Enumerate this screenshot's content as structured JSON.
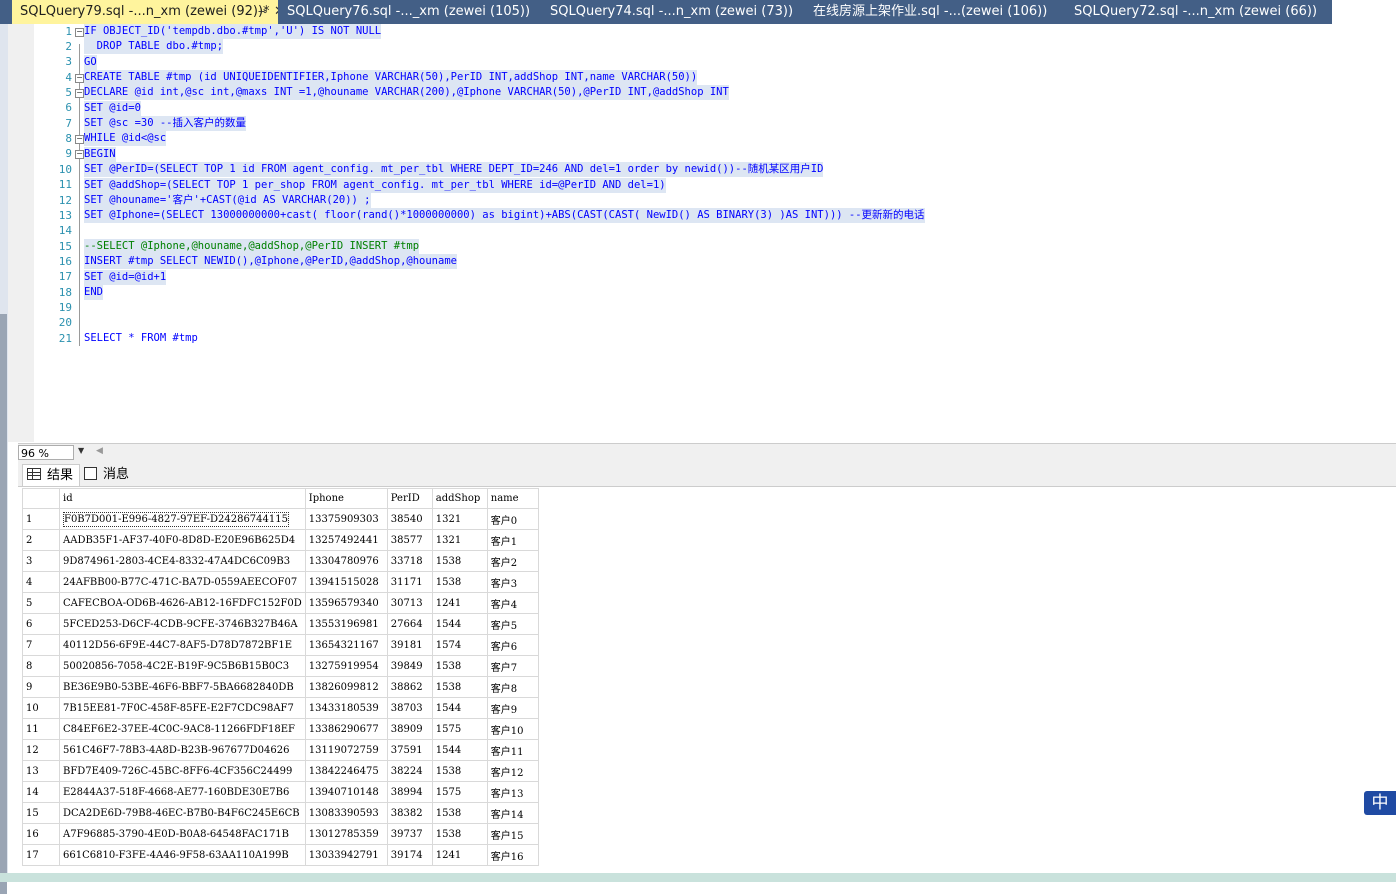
{
  "tabs": [
    {
      "label": "SQLQuery79.sql -...n_xm (zewei (92))*",
      "active": true,
      "pin": "⊸",
      "close": "✕"
    },
    {
      "label": "SQLQuery76.sql -..._xm (zewei (105))",
      "active": false
    },
    {
      "label": "SQLQuery74.sql -...n_xm (zewei (73))",
      "active": false
    },
    {
      "label": "在线房源上架作业.sql -...(zewei (106))",
      "active": false
    },
    {
      "label": "SQLQuery72.sql -...n_xm (zewei (66))",
      "active": false
    }
  ],
  "editor": {
    "line_numbers": [
      "1",
      "2",
      "3",
      "4",
      "5",
      "6",
      "7",
      "8",
      "9",
      "10",
      "11",
      "12",
      "13",
      "14",
      "15",
      "16",
      "17",
      "18",
      "19",
      "20",
      "21"
    ],
    "lines": [
      "IF OBJECT_ID('tempdb.dbo.#tmp','U') IS NOT NULL",
      "  DROP TABLE dbo.#tmp;",
      "GO",
      "CREATE TABLE #tmp (id UNIQUEIDENTIFIER,Iphone VARCHAR(50),PerID INT,addShop INT,name VARCHAR(50))",
      "DECLARE @id int,@sc int,@maxs INT =1,@houname VARCHAR(200),@Iphone VARCHAR(50),@PerID INT,@addShop INT",
      "SET @id=0",
      "SET @sc =30 --插入客户的数量",
      "WHILE @id<@sc",
      "BEGIN",
      "SET @PerID=(SELECT TOP 1 id FROM agent_config. mt_per_tbl WHERE DEPT_ID=246 AND del=1 order by newid())--随机某区用户ID",
      "SET @addShop=(SELECT TOP 1 per_shop FROM agent_config. mt_per_tbl WHERE id=@PerID AND del=1)",
      "SET @houname='客户'+CAST(@id AS VARCHAR(20)) ;",
      "SET @Iphone=(SELECT 13000000000+cast( floor(rand()*1000000000) as bigint)+ABS(CAST(CAST( NewID() AS BINARY(3) )AS INT))) --更新新的电话",
      "",
      "--SELECT @Iphone,@houname,@addShop,@PerID INSERT #tmp",
      "INSERT #tmp SELECT NEWID(),@Iphone,@PerID,@addShop,@houname",
      "SET @id=@id+1",
      "END",
      "",
      "",
      "SELECT * FROM #tmp"
    ]
  },
  "zoom": {
    "value": "96 %"
  },
  "results_tabs": [
    {
      "label": "结果",
      "icon": "grid-icon",
      "active": true
    },
    {
      "label": "消息",
      "icon": "message-icon",
      "active": false
    }
  ],
  "grid": {
    "columns": [
      "id",
      "Iphone",
      "PerID",
      "addShop",
      "name"
    ],
    "rows": [
      [
        "1",
        "F0B7D001-E996-4827-97EF-D24286744115",
        "13375909303",
        "38540",
        "1321",
        "客户0"
      ],
      [
        "2",
        "AADB35F1-AF37-40F0-8D8D-E20E96B625D4",
        "13257492441",
        "38577",
        "1321",
        "客户1"
      ],
      [
        "3",
        "9D874961-2803-4CE4-8332-47A4DC6C09B3",
        "13304780976",
        "33718",
        "1538",
        "客户2"
      ],
      [
        "4",
        "24AFBB00-B77C-471C-BA7D-0559AEECOF07",
        "13941515028",
        "31171",
        "1538",
        "客户3"
      ],
      [
        "5",
        "CAFECBOA-OD6B-4626-AB12-16FDFC152F0D",
        "13596579340",
        "30713",
        "1241",
        "客户4"
      ],
      [
        "6",
        "5FCED253-D6CF-4CDB-9CFE-3746B327B46A",
        "13553196981",
        "27664",
        "1544",
        "客户5"
      ],
      [
        "7",
        "40112D56-6F9E-44C7-8AF5-D78D7872BF1E",
        "13654321167",
        "39181",
        "1574",
        "客户6"
      ],
      [
        "8",
        "50020856-7058-4C2E-B19F-9C5B6B15B0C3",
        "13275919954",
        "39849",
        "1538",
        "客户7"
      ],
      [
        "9",
        "BE36E9B0-53BE-46F6-BBF7-5BA6682840DB",
        "13826099812",
        "38862",
        "1538",
        "客户8"
      ],
      [
        "10",
        "7B15EE81-7F0C-458F-85FE-E2F7CDC98AF7",
        "13433180539",
        "38703",
        "1544",
        "客户9"
      ],
      [
        "11",
        "C84EF6E2-37EE-4C0C-9AC8-11266FDF18EF",
        "13386290677",
        "38909",
        "1575",
        "客户10"
      ],
      [
        "12",
        "561C46F7-78B3-4A8D-B23B-967677D04626",
        "13119072759",
        "37591",
        "1544",
        "客户11"
      ],
      [
        "13",
        "BFD7E409-726C-45BC-8FF6-4CF356C24499",
        "13842246475",
        "38224",
        "1538",
        "客户12"
      ],
      [
        "14",
        "E2844A37-518F-4668-AE77-160BDE30E7B6",
        "13940710148",
        "38994",
        "1575",
        "客户13"
      ],
      [
        "15",
        "DCA2DE6D-79B8-46EC-B7B0-B4F6C245E6CB",
        "13083390593",
        "38382",
        "1538",
        "客户14"
      ],
      [
        "16",
        "A7F96885-3790-4E0D-B0A8-64548FAC171B",
        "13012785359",
        "39737",
        "1538",
        "客户15"
      ],
      [
        "17",
        "661C6810-F3FE-4A46-9F58-63AA110A199B",
        "13033942791",
        "39174",
        "1241",
        "客户16"
      ]
    ]
  },
  "ime": {
    "label": "中"
  }
}
